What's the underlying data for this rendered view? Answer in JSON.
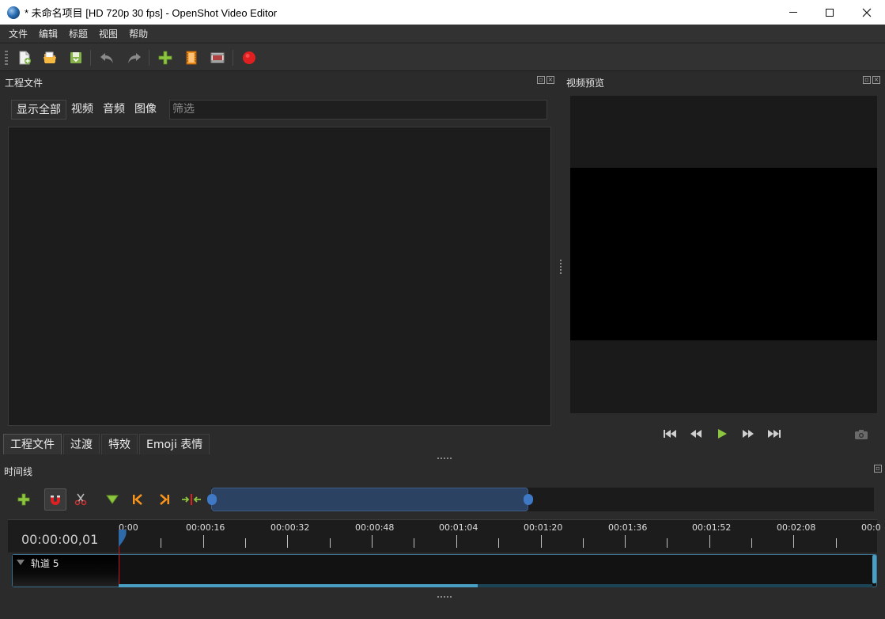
{
  "window": {
    "title": "* 未命名项目 [HD 720p 30 fps] - OpenShot Video Editor"
  },
  "menu": [
    "文件",
    "编辑",
    "标题",
    "视图",
    "帮助"
  ],
  "panels": {
    "project_files_title": "工程文件",
    "preview_title": "视频预览",
    "timeline_title": "时间线"
  },
  "filters": {
    "buttons": [
      "显示全部",
      "视频",
      "音频",
      "图像"
    ],
    "placeholder": "筛选"
  },
  "bottom_tabs": [
    "工程文件",
    "过渡",
    "特效",
    "Emoji 表情"
  ],
  "timeline": {
    "timecode": "00:00:00,01",
    "ticks": [
      "0:00",
      "00:00:16",
      "00:00:32",
      "00:00:48",
      "00:01:04",
      "00:01:20",
      "00:01:36",
      "00:01:52",
      "00:02:08",
      "00:0"
    ],
    "track_label": "轨道 5"
  },
  "icons": {
    "toolbar": [
      "new-project-icon",
      "open-project-icon",
      "save-project-icon",
      "undo-icon",
      "redo-icon",
      "import-files-icon",
      "profile-icon",
      "fullscreen-icon",
      "export-video-icon"
    ],
    "timeline_toolbar": [
      "add-track-icon",
      "snapping-icon",
      "razor-icon",
      "add-marker-icon",
      "previous-marker-icon",
      "next-marker-icon",
      "center-timeline-icon"
    ],
    "playback": [
      "jump-start-icon",
      "rewind-icon",
      "play-icon",
      "fast-forward-icon",
      "jump-end-icon"
    ]
  },
  "colors": {
    "accent_green": "#8cc63f",
    "accent_orange": "#f7941d",
    "record_red": "#e02020",
    "playhead_red": "#c4161c",
    "track_blue": "#4aa0c4"
  }
}
